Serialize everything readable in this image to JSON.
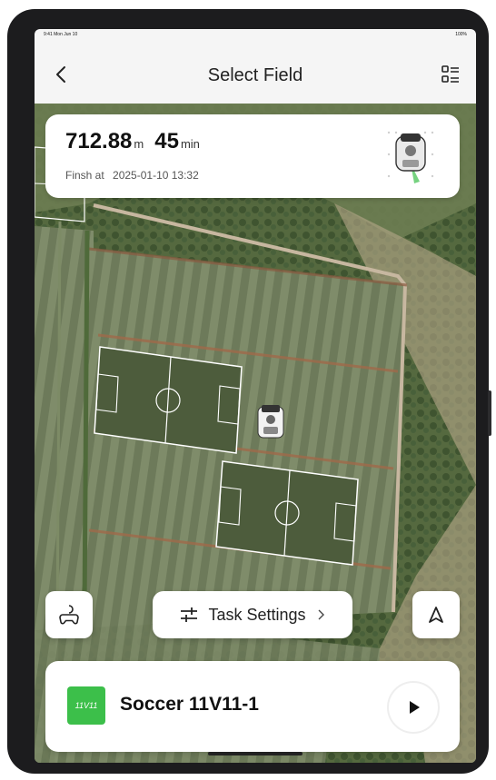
{
  "statusbar": {
    "time": "9:41  Mon Jun 10",
    "right": "100%"
  },
  "header": {
    "title": "Select Field",
    "back_icon": "chevron-left-icon",
    "menu_icon": "list-icon"
  },
  "stats": {
    "distance_value": "712.88",
    "distance_unit": "m",
    "duration_value": "45",
    "duration_unit": "min",
    "finish_label": "Finsh at",
    "finish_time": "2025-01-10  13:32"
  },
  "controls": {
    "task_settings_label": "Task Settings",
    "task_settings_icon": "sliders-icon",
    "remote_icon": "gamepad-icon",
    "navigate_icon": "navigation-arrow-icon"
  },
  "field": {
    "badge": "11V11",
    "name": "Soccer 11V11-1",
    "play_icon": "play-icon"
  },
  "colors": {
    "accent_green": "#3cbf4a",
    "field_line": "#ffffff",
    "map_dark": "#5b6a4a"
  }
}
